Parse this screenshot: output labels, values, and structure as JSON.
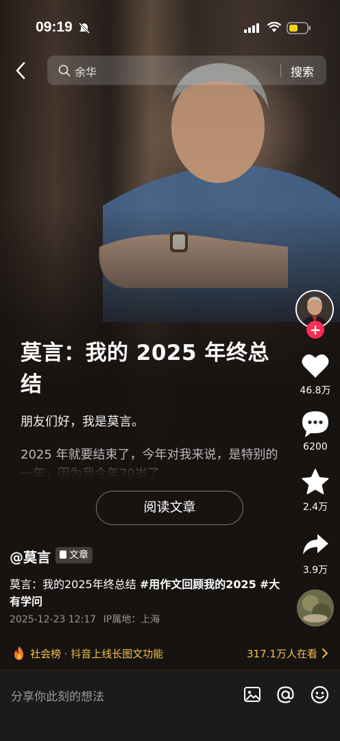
{
  "status_bar": {
    "time": "09:19"
  },
  "search": {
    "query": "余华",
    "button_label": "搜索"
  },
  "article": {
    "title": "莫言：我的 2025 年终总结",
    "paragraph1": "朋友们好，我是莫言。",
    "paragraph2": "2025 年就要结束了，今年对我来说，是特别的一年，因为我今年70岁了",
    "read_button": "阅读文章"
  },
  "rail": {
    "like_count": "46.8万",
    "comment_count": "6200",
    "favorite_count": "2.4万",
    "share_count": "3.9万",
    "follow_plus": "+"
  },
  "post": {
    "author": "@莫言",
    "tag": "文章",
    "desc_text": "莫言：我的2025年终总结 ",
    "hashtag1": "#用作文回顾我的2025",
    "hashtag2": "#大有学问",
    "date": "2025-12-23 12:17",
    "ip": "IP属地：上海"
  },
  "hot": {
    "label": "社会榜 · 抖音上线长图文功能",
    "watching": "317.1万人在看"
  },
  "comment_bar": {
    "placeholder": "分享你此刻的想法"
  },
  "colors": {
    "accent_red": "#fe2c55",
    "hot_gold": "#f4c04a",
    "battery_yellow": "#f7d21a"
  }
}
